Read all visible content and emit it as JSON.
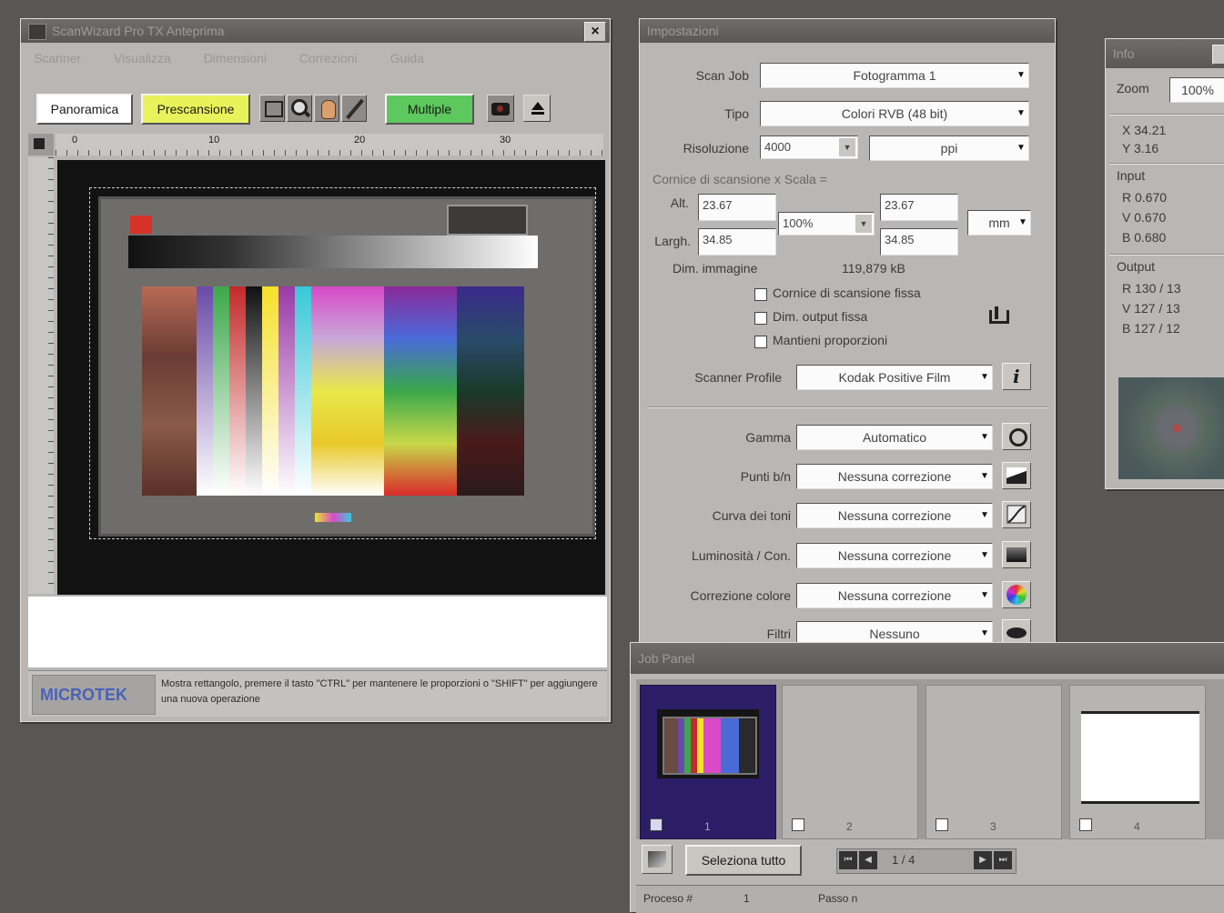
{
  "scan_window": {
    "title": "ScanWizard Pro TX Anteprima",
    "menu": [
      "Scanner",
      "Visualizza",
      "Dimensioni",
      "Correzioni",
      "Guida"
    ],
    "buttons": {
      "overview": "Panoramica",
      "prescan": "Prescansione",
      "multiple": "Multiple"
    },
    "ruler_top": [
      "0",
      "10",
      "20",
      "30"
    ],
    "status_logo": "MICROTEK",
    "status_text": "Mostra rettangolo, premere il tasto \"CTRL\" per mantenere le proporzioni o \"SHIFT\" per aggiungere una nuova operazione"
  },
  "settings": {
    "title": "Impostazioni",
    "scan_job_label": "Scan Job",
    "scan_job_value": "Fotogramma 1",
    "type_label": "Tipo",
    "type_value": "Colori RVB (48 bit)",
    "resolution_label": "Risoluzione",
    "resolution_value": "4000",
    "resolution_unit": "ppi",
    "frame_scale_label": "Cornice di scansione  x  Scala  =",
    "alt_label": "Alt.",
    "alt_value": "23.67",
    "alt_out": "23.67",
    "width_label": "Largh.",
    "width_value": "34.85",
    "width_out": "34.85",
    "scale_value": "100%",
    "unit_value": "mm",
    "image_size_label": "Dim. immagine",
    "image_size_value": "119,879 kB",
    "check_fixed_frame": "Cornice di scansione fissa",
    "check_fixed_output": "Dim. output fissa",
    "check_keep_proportions": "Mantieni proporzioni",
    "profile_label": "Scanner Profile",
    "profile_value": "Kodak Positive Film",
    "gamma_label": "Gamma",
    "gamma_value": "Automatico",
    "whitepoint_label": "Punti b/n",
    "whitepoint_value": "Nessuna correzione",
    "tone_label": "Curva dei toni",
    "tone_value": "Nessuna correzione",
    "brightness_label": "Luminosità / Con.",
    "brightness_value": "Nessuna correzione",
    "color_label": "Correzione colore",
    "color_value": "Nessuna correzione",
    "filter_label": "Filtri",
    "filter_value": "Nessuno"
  },
  "info": {
    "title": "Info",
    "zoom_label": "Zoom",
    "zoom_value": "100%",
    "x_readout": "X  34.21",
    "y_readout": "Y  3.16",
    "input_label": "Input",
    "input_r": "R  0.670",
    "input_v": "V  0.670",
    "input_b": "B  0.680",
    "output_label": "Output",
    "output_r": "R  130  /  13",
    "output_v": "V  127  /  13",
    "output_b": "B  127  /  12"
  },
  "job_panel": {
    "title": "Job Panel",
    "frames": [
      "1",
      "2",
      "3",
      "4"
    ],
    "select_all": "Seleziona tutto",
    "page": "1 / 4",
    "footer_left": "Proceso #",
    "footer_left_value": "1",
    "footer_right": "Passo n"
  },
  "colors": {
    "desktop": "#595656",
    "panel": "#b9b6b3",
    "prescan_yellow": "#e8f25a",
    "multiple_green": "#5dc85d",
    "logo_blue": "#4a62b8",
    "thumb_purple": "#2b1e66"
  }
}
